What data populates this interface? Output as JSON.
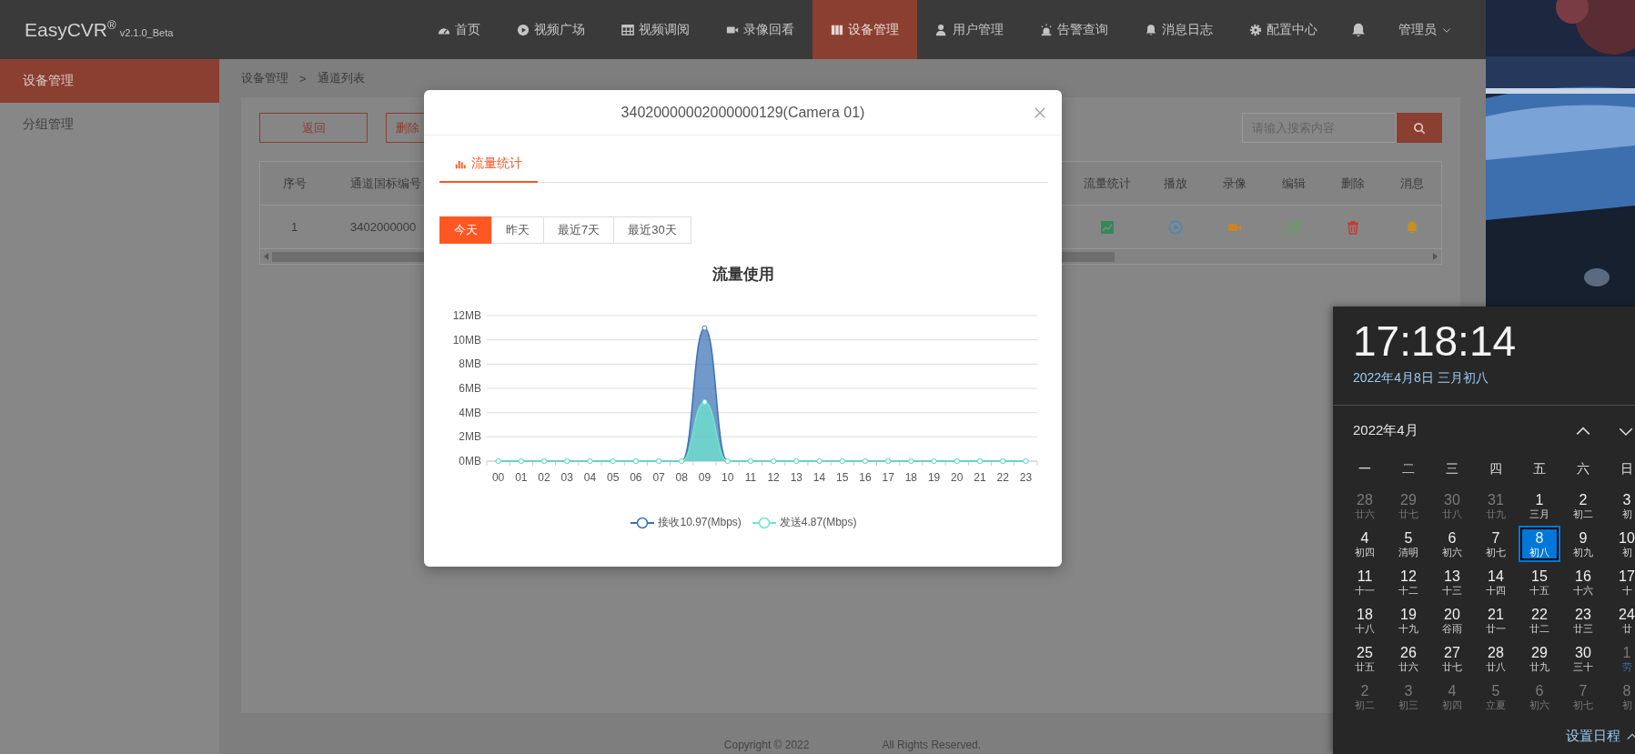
{
  "header": {
    "logo": "EasyCVR$^{®}$",
    "version": "v2.1.0_Beta",
    "nav": [
      {
        "label": "首页",
        "selected": false
      },
      {
        "label": "视频广场",
        "selected": false
      },
      {
        "label": "视频调阅",
        "selected": false
      },
      {
        "label": "录像回看",
        "selected": false
      },
      {
        "label": "设备管理",
        "selected": true
      },
      {
        "label": "用户管理",
        "selected": false
      },
      {
        "label": "告警查询",
        "selected": false
      },
      {
        "label": "消息日志",
        "selected": false
      },
      {
        "label": "配置中心",
        "selected": false
      }
    ],
    "user": "管理员"
  },
  "sidebar": {
    "items": [
      {
        "label": "设备管理",
        "selected": true
      },
      {
        "label": "分组管理",
        "selected": false
      }
    ]
  },
  "breadcrumb": {
    "items": [
      "设备管理",
      "通道列表"
    ],
    "separator": ">"
  },
  "toolbar": {
    "buttons": [
      "返回",
      "删除"
    ],
    "search": {
      "placeholder": "请输入搜索内容"
    }
  },
  "table": {
    "columns": [
      "序号",
      "通道国标编号",
      "流量统计",
      "播放",
      "录像",
      "编辑",
      "删除",
      "消息"
    ],
    "rows": [
      {
        "cells": [
          "1",
          "3402000000"
        ]
      }
    ]
  },
  "footer": [
    "Copyright © 2022",
    "All Rights Reserved."
  ],
  "modal": {
    "title": "34020000002000000129(Camera 01)",
    "tabs": [
      {
        "label": "流量统计",
        "selected": true
      }
    ],
    "ranges": [
      {
        "label": "今天",
        "selected": true
      },
      {
        "label": "昨天",
        "selected": false
      },
      {
        "label": "最近7天",
        "selected": false
      },
      {
        "label": "最近30天",
        "selected": false
      }
    ],
    "chart_data": {
      "type": "area",
      "title": "流量使用",
      "x": [
        "00",
        "01",
        "02",
        "03",
        "04",
        "05",
        "06",
        "07",
        "08",
        "09",
        "10",
        "11",
        "12",
        "13",
        "14",
        "15",
        "16",
        "17",
        "18",
        "19",
        "20",
        "21",
        "22",
        "23"
      ],
      "series": [
        {
          "name": "接收10.97(Mbps)",
          "color": "#3a72b5",
          "values": [
            0,
            0,
            0,
            0,
            0,
            0,
            0,
            0,
            0,
            10.97,
            0,
            0,
            0,
            0,
            0,
            0,
            0,
            0,
            0,
            0,
            0,
            0,
            0,
            0
          ]
        },
        {
          "name": "发送4.87(Mbps)",
          "color": "#6fe6cc",
          "values": [
            0,
            0,
            0,
            0,
            0,
            0,
            0,
            0,
            0,
            4.87,
            0,
            0,
            0,
            0,
            0,
            0,
            0,
            0,
            0,
            0,
            0,
            0,
            0,
            0
          ]
        }
      ],
      "ylim": [
        0,
        12
      ],
      "grid": true,
      "yticks": [
        {
          "value": 0,
          "label": "0MB"
        },
        {
          "value": 2,
          "label": "2MB"
        },
        {
          "value": 4,
          "label": "4MB"
        },
        {
          "value": 6,
          "label": "6MB"
        },
        {
          "value": 8,
          "label": "8MB"
        },
        {
          "value": 10,
          "label": "10MB"
        },
        {
          "value": 12,
          "label": "12MB"
        }
      ]
    }
  },
  "calendar": {
    "time": "17:18:14",
    "date": "2022年4月8日 三月初八",
    "month": "2022年4月",
    "weekdays": [
      "一",
      "二",
      "三",
      "四",
      "五",
      "六",
      "日"
    ],
    "weeks": [
      [
        {
          "day": "28",
          "lunar": "廿六",
          "muted": true,
          "selected": false,
          "festival": false
        },
        {
          "day": "29",
          "lunar": "廿七",
          "muted": true,
          "selected": false,
          "festival": false
        },
        {
          "day": "30",
          "lunar": "廿八",
          "muted": true,
          "selected": false,
          "festival": false
        },
        {
          "day": "31",
          "lunar": "廿九",
          "muted": true,
          "selected": false,
          "festival": false
        },
        {
          "day": "1",
          "lunar": "三月",
          "muted": false,
          "selected": false,
          "festival": false
        },
        {
          "day": "2",
          "lunar": "初二",
          "muted": false,
          "selected": false,
          "festival": false
        },
        {
          "day": "3",
          "lunar": "初",
          "muted": false,
          "selected": false,
          "festival": false
        }
      ],
      [
        {
          "day": "4",
          "lunar": "初四",
          "muted": false,
          "selected": false,
          "festival": false
        },
        {
          "day": "5",
          "lunar": "清明",
          "muted": false,
          "selected": false,
          "festival": false
        },
        {
          "day": "6",
          "lunar": "初六",
          "muted": false,
          "selected": false,
          "festival": false
        },
        {
          "day": "7",
          "lunar": "初七",
          "muted": false,
          "selected": false,
          "festival": false
        },
        {
          "day": "8",
          "lunar": "初八",
          "muted": false,
          "selected": true,
          "festival": false
        },
        {
          "day": "9",
          "lunar": "初九",
          "muted": false,
          "selected": false,
          "festival": false
        },
        {
          "day": "10",
          "lunar": "初",
          "muted": false,
          "selected": false,
          "festival": false
        }
      ],
      [
        {
          "day": "11",
          "lunar": "十一",
          "muted": false,
          "selected": false,
          "festival": false
        },
        {
          "day": "12",
          "lunar": "十二",
          "muted": false,
          "selected": false,
          "festival": false
        },
        {
          "day": "13",
          "lunar": "十三",
          "muted": false,
          "selected": false,
          "festival": false
        },
        {
          "day": "14",
          "lunar": "十四",
          "muted": false,
          "selected": false,
          "festival": false
        },
        {
          "day": "15",
          "lunar": "十五",
          "muted": false,
          "selected": false,
          "festival": false
        },
        {
          "day": "16",
          "lunar": "十六",
          "muted": false,
          "selected": false,
          "festival": false
        },
        {
          "day": "17",
          "lunar": "十",
          "muted": false,
          "selected": false,
          "festival": false
        }
      ],
      [
        {
          "day": "18",
          "lunar": "十八",
          "muted": false,
          "selected": false,
          "festival": false
        },
        {
          "day": "19",
          "lunar": "十九",
          "muted": false,
          "selected": false,
          "festival": false
        },
        {
          "day": "20",
          "lunar": "谷雨",
          "muted": false,
          "selected": false,
          "festival": false
        },
        {
          "day": "21",
          "lunar": "廿一",
          "muted": false,
          "selected": false,
          "festival": false
        },
        {
          "day": "22",
          "lunar": "廿二",
          "muted": false,
          "selected": false,
          "festival": false
        },
        {
          "day": "23",
          "lunar": "廿三",
          "muted": false,
          "selected": false,
          "festival": false
        },
        {
          "day": "24",
          "lunar": "廿",
          "muted": false,
          "selected": false,
          "festival": false
        }
      ],
      [
        {
          "day": "25",
          "lunar": "廿五",
          "muted": false,
          "selected": false,
          "festival": false
        },
        {
          "day": "26",
          "lunar": "廿六",
          "muted": false,
          "selected": false,
          "festival": false
        },
        {
          "day": "27",
          "lunar": "廿七",
          "muted": false,
          "selected": false,
          "festival": false
        },
        {
          "day": "28",
          "lunar": "廿八",
          "muted": false,
          "selected": false,
          "festival": false
        },
        {
          "day": "29",
          "lunar": "廿九",
          "muted": false,
          "selected": false,
          "festival": false
        },
        {
          "day": "30",
          "lunar": "三十",
          "muted": false,
          "selected": false,
          "festival": false
        },
        {
          "day": "1",
          "lunar": "劳",
          "muted": true,
          "selected": false,
          "festival": true
        }
      ],
      [
        {
          "day": "2",
          "lunar": "初二",
          "muted": true,
          "selected": false,
          "festival": false
        },
        {
          "day": "3",
          "lunar": "初三",
          "muted": true,
          "selected": false,
          "festival": false
        },
        {
          "day": "4",
          "lunar": "初四",
          "muted": true,
          "selected": false,
          "festival": false
        },
        {
          "day": "5",
          "lunar": "立夏",
          "muted": true,
          "selected": false,
          "festival": false
        },
        {
          "day": "6",
          "lunar": "初六",
          "muted": true,
          "selected": false,
          "festival": false
        },
        {
          "day": "7",
          "lunar": "初七",
          "muted": true,
          "selected": false,
          "festival": false
        },
        {
          "day": "8",
          "lunar": "初",
          "muted": true,
          "selected": false,
          "festival": false
        }
      ]
    ],
    "footer": "设置日程"
  }
}
